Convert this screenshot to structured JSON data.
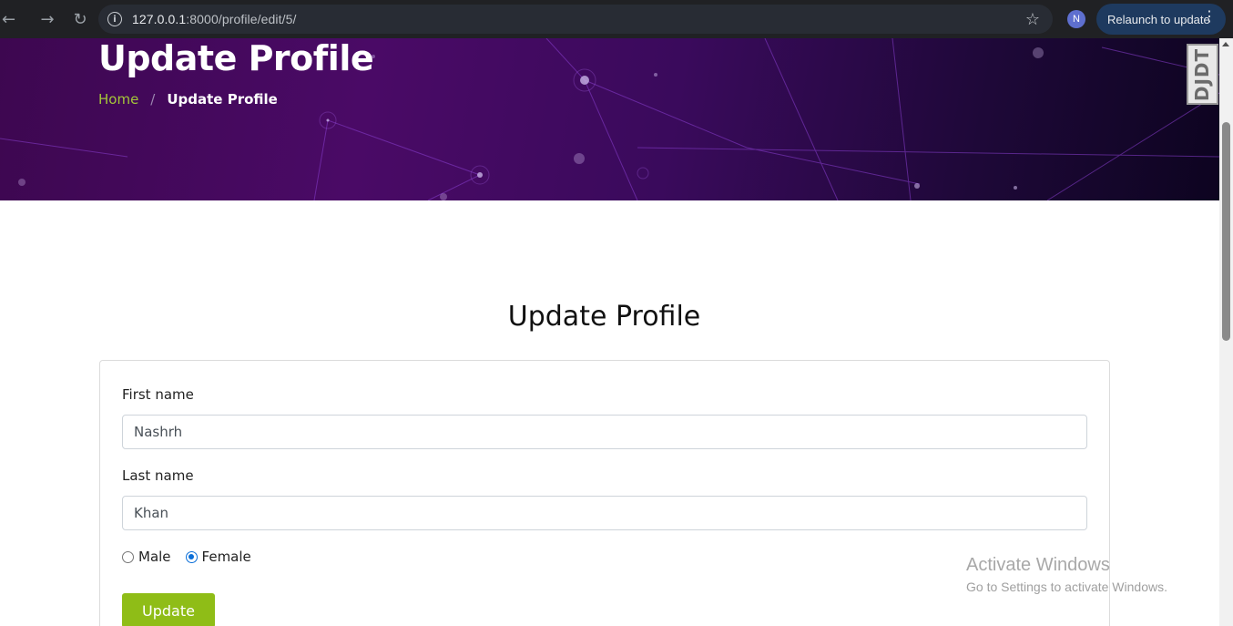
{
  "browser": {
    "url_host": "127.0.0.1",
    "url_path": ":8000/profile/edit/5/",
    "profile_initial": "N",
    "relaunch_label": "Relaunch to update"
  },
  "hero": {
    "title": "Update Profile",
    "breadcrumb": {
      "home": "Home",
      "separator": "/",
      "current": "Update Profile"
    }
  },
  "debug_toolbar": {
    "label": "DJDT"
  },
  "form": {
    "heading": "Update Profile",
    "first_name": {
      "label": "First name",
      "value": "Nashrh"
    },
    "last_name": {
      "label": "Last name",
      "value": "Khan"
    },
    "gender": {
      "options": [
        "Male",
        "Female"
      ],
      "selected": "Female"
    },
    "submit_label": "Update"
  },
  "watermark": {
    "line1": "Activate Windows",
    "line2": "Go to Settings to activate Windows."
  },
  "colors": {
    "accent_green": "#8fbd17",
    "breadcrumb_link": "#a4c639",
    "hero_purple": "#4a0a66",
    "radio_selected": "#0b6fd8"
  }
}
